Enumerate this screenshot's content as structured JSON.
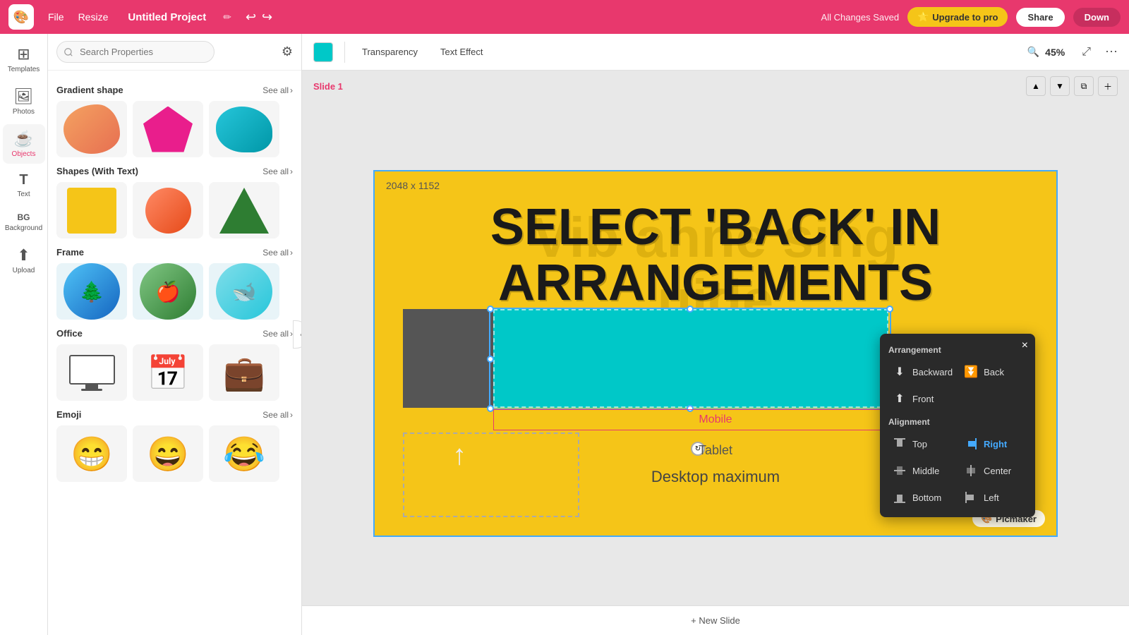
{
  "topbar": {
    "logo_text": "P",
    "menu_items": [
      "File",
      "Resize"
    ],
    "project_title": "Untitled Project",
    "saved_text": "All Changes Saved",
    "upgrade_label": "Upgrade to pro",
    "share_label": "Share",
    "download_label": "Down"
  },
  "toolbar": {
    "transparency_label": "Transparency",
    "text_effect_label": "Text Effect",
    "zoom_level": "45%"
  },
  "left_panel": {
    "search_placeholder": "Search Properties",
    "sections": [
      {
        "title": "Gradient shape",
        "see_all_label": "See all"
      },
      {
        "title": "Shapes (With Text)",
        "see_all_label": "See all"
      },
      {
        "title": "Frame",
        "see_all_label": "See all"
      },
      {
        "title": "Office",
        "see_all_label": "See all"
      },
      {
        "title": "Emoji",
        "see_all_label": "See all"
      }
    ]
  },
  "sidebar": {
    "items": [
      {
        "label": "Templates",
        "icon": "⊞"
      },
      {
        "label": "Photos",
        "icon": "🖼"
      },
      {
        "label": "Objects",
        "icon": "☕"
      },
      {
        "label": "Text",
        "icon": "T"
      },
      {
        "label": "Background",
        "icon": "BG"
      },
      {
        "label": "Upload",
        "icon": "⬆"
      }
    ]
  },
  "slide": {
    "label": "Slide 1",
    "dimensions_text": "2048 x 1152",
    "big_text_line1": "SELECT 'BACK' IN",
    "big_text_line2": "ARRANGEMENTS",
    "bg_text_line1": "Vib  anne  sing",
    "bg_text_line2": "uide",
    "mobile_label": "Mobile",
    "tablet_label": "Tablet",
    "desktop_label": "Desktop maximum",
    "picmaker_label": "Picmaker"
  },
  "context_menu": {
    "arrangement_title": "Arrangement",
    "backward_label": "Backward",
    "back_label": "Back",
    "front_label": "Front",
    "alignment_title": "Alignment",
    "align_items": [
      {
        "label": "Top",
        "icon": "⬆"
      },
      {
        "label": "Right",
        "icon": "➡"
      },
      {
        "label": "Middle",
        "icon": "↕"
      },
      {
        "label": "Center",
        "icon": "↔"
      },
      {
        "label": "Bottom",
        "icon": "⬇"
      },
      {
        "label": "Left",
        "icon": "⬅"
      }
    ],
    "close_icon": "×"
  },
  "new_slide_label": "+ New Slide"
}
